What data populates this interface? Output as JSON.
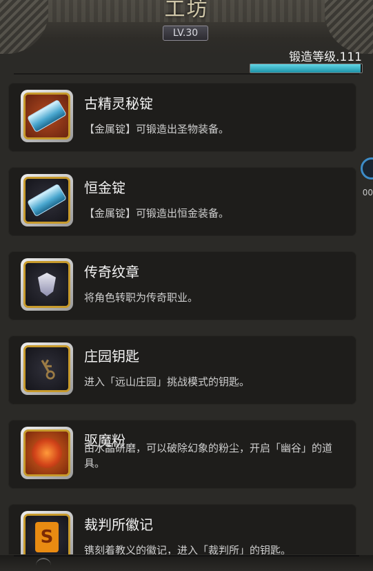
{
  "header": {
    "title": "工坊",
    "level_badge": "LV.30",
    "forge_level_label": "锻造等级.111",
    "forge_progress": 0.99
  },
  "edge_label": "00",
  "items": [
    {
      "name": "古精灵秘锭",
      "description": "【金属锭】可锻造出圣物装备。",
      "icon": "ingot-icon"
    },
    {
      "name": "恒金锭",
      "description": "【金属锭】可锻造出恒金装备。",
      "icon": "ingot-icon"
    },
    {
      "name": "传奇纹章",
      "description": "将角色转职为传奇职业。",
      "icon": "emblem-icon"
    },
    {
      "name": "庄园钥匙",
      "description": "进入「远山庄园」挑战模式的钥匙。",
      "icon": "key-icon"
    },
    {
      "name": "驱魔粉",
      "description": "由水晶研磨，可以破除幻象的粉尘，开启「幽谷」的道具。",
      "icon": "powder-icon"
    },
    {
      "name": "裁判所徽记",
      "description": "镌刻着教义的徽记，进入「裁判所」的钥匙。",
      "icon": "seal-icon"
    }
  ],
  "colors": {
    "progress": "#1d93a8",
    "icon_border_gold": "#c79a2c"
  }
}
